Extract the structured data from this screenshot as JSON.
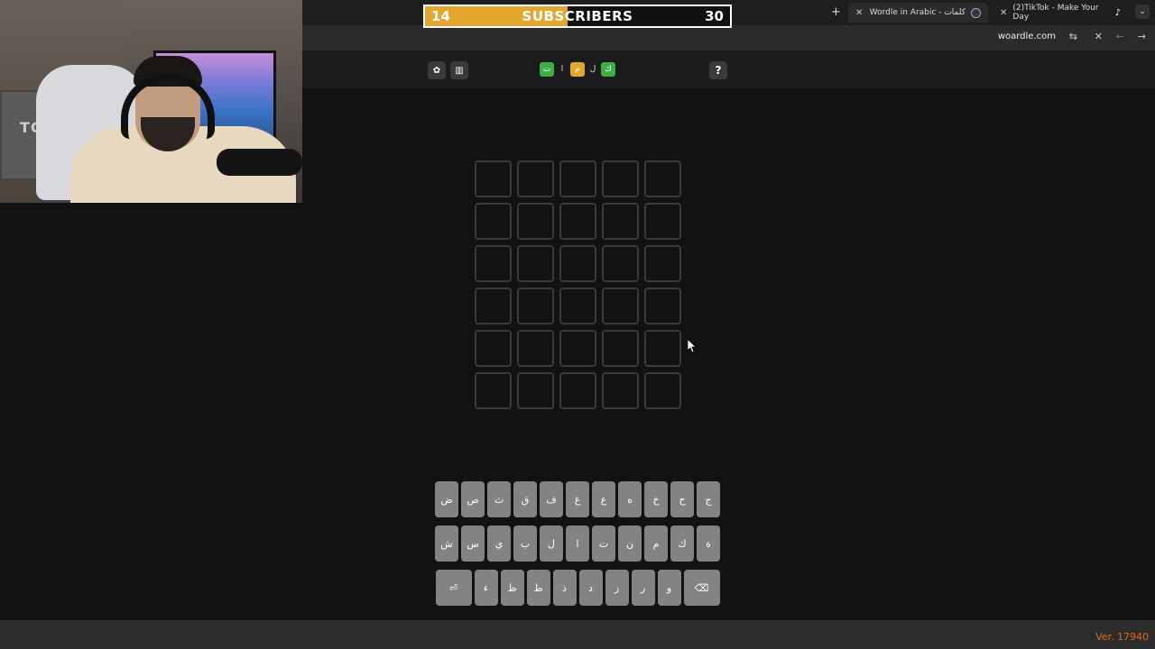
{
  "subscribers": {
    "current": "14",
    "label": "SUBSCRIBERS",
    "goal": "30",
    "progress": 0.4667,
    "fill_color": "#e5a62f"
  },
  "webcam": {
    "box_text": "TCL"
  },
  "tabs": [
    {
      "title": "Wordle in Arabic - كلمات",
      "active": true
    },
    {
      "title": "(2)TikTok - Make Your Day",
      "active": false
    }
  ],
  "browser": {
    "url": "woardle.com"
  },
  "header": {
    "logo_tiles": [
      {
        "char": "ت",
        "color": "#3fae49"
      },
      {
        "char": "ا",
        "color": ""
      },
      {
        "char": "م",
        "color": "#e5a62f"
      },
      {
        "char": "ل",
        "color": ""
      },
      {
        "char": "ك",
        "color": "#3fae49"
      }
    ],
    "help_label": "?"
  },
  "keyboard": {
    "row1": [
      "ض",
      "ص",
      "ث",
      "ق",
      "ف",
      "غ",
      "ع",
      "ه",
      "خ",
      "ح",
      "ج"
    ],
    "row2": [
      "ش",
      "س",
      "ي",
      "ب",
      "ل",
      "ا",
      "ت",
      "ن",
      "م",
      "ك",
      "ة"
    ],
    "row3": [
      "ء",
      "ظ",
      "ط",
      "ذ",
      "د",
      "ز",
      "ر",
      "و"
    ],
    "enter_glyph": "⏎",
    "backspace_glyph": "⌫"
  },
  "footer": {
    "version": "Ver. 17940"
  }
}
